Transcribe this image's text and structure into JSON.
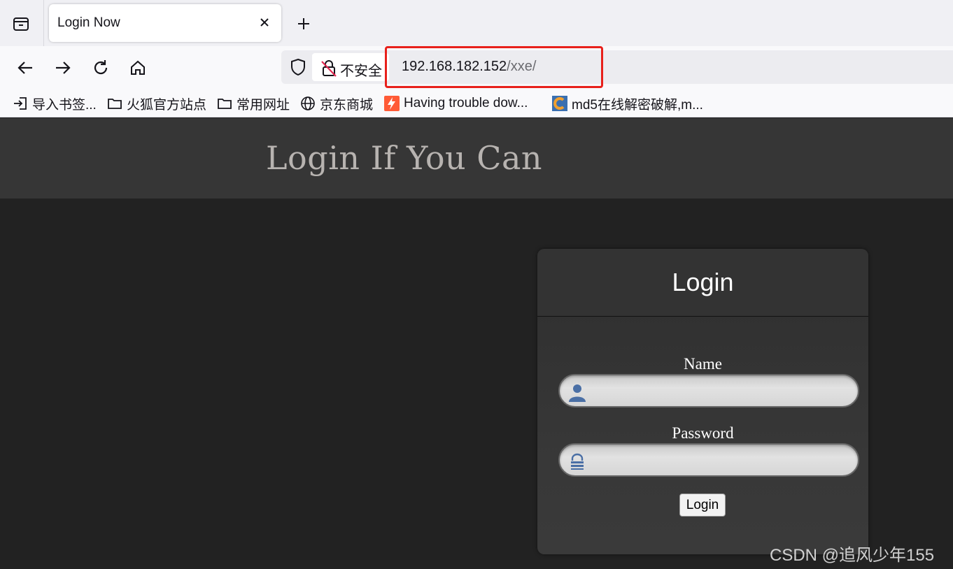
{
  "browser": {
    "tab": {
      "title": "Login Now",
      "close_symbol": "×"
    },
    "new_tab_symbol": "+",
    "address": {
      "security_label": "不安全",
      "host": "192.168.182.152",
      "path": "/xxe/"
    },
    "bookmarks": [
      {
        "label": "导入书签...",
        "icon": "import-icon"
      },
      {
        "label": "火狐官方站点",
        "icon": "folder-icon"
      },
      {
        "label": "常用网址",
        "icon": "folder-icon"
      },
      {
        "label": "京东商城",
        "icon": "globe-icon"
      },
      {
        "label": "Having trouble dow...",
        "icon": "lightning-favicon"
      },
      {
        "label": "md5在线解密破解,m...",
        "icon": "md5-favicon"
      }
    ],
    "highlight_color": "#e8201b"
  },
  "page": {
    "site_title": "Login If You Can",
    "login_panel": {
      "heading": "Login",
      "name_label": "Name",
      "password_label": "Password",
      "button_label": "Login",
      "name_icon": "user-icon",
      "password_icon": "lock-icon"
    }
  },
  "watermark": "CSDN @追风少年155",
  "colors": {
    "header_bg": "#363636",
    "page_bg": "#222222",
    "title_color": "#b7b3b0",
    "icon_blue": "#4a6fa5"
  }
}
